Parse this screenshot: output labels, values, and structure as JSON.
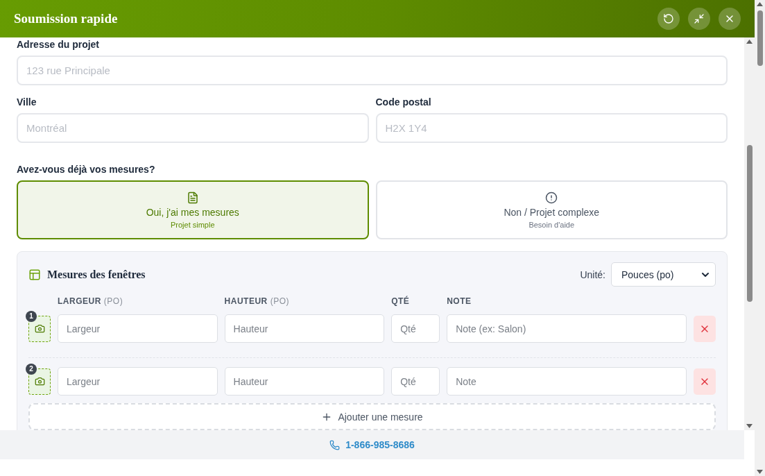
{
  "header": {
    "title": "Soumission rapide"
  },
  "address": {
    "label": "Adresse du projet",
    "placeholder": "123 rue Principale"
  },
  "city": {
    "label": "Ville",
    "placeholder": "Montréal"
  },
  "postal": {
    "label": "Code postal",
    "placeholder": "H2X 1Y4"
  },
  "question": "Avez-vous déjà vos mesures?",
  "choices": [
    {
      "kind": "document",
      "title": "Oui, j'ai mes mesures",
      "subtitle": "Projet simple",
      "selected": true
    },
    {
      "kind": "alert",
      "title": "Non / Projet complexe",
      "subtitle": "Besoin d'aide",
      "selected": false
    }
  ],
  "measures": {
    "title": "Mesures des fenêtres",
    "unit_label": "Unité:",
    "unit_value": "Pouces (po)",
    "columns": [
      {
        "label": "LARGEUR",
        "unit": "(PO)"
      },
      {
        "label": "HAUTEUR",
        "unit": "(PO)"
      },
      {
        "label": "QTÉ"
      },
      {
        "label": "NOTE"
      }
    ],
    "rows": [
      {
        "number": "1",
        "width_placeholder": "Largeur",
        "height_placeholder": "Hauteur",
        "qty_placeholder": "Qté",
        "note_placeholder": "Note (ex: Salon)"
      },
      {
        "number": "2",
        "width_placeholder": "Largeur",
        "height_placeholder": "Hauteur",
        "qty_placeholder": "Qté",
        "note_placeholder": "Note"
      }
    ],
    "add_button": "Ajouter une mesure"
  },
  "footer": {
    "phone": "1-866-985-8686"
  }
}
